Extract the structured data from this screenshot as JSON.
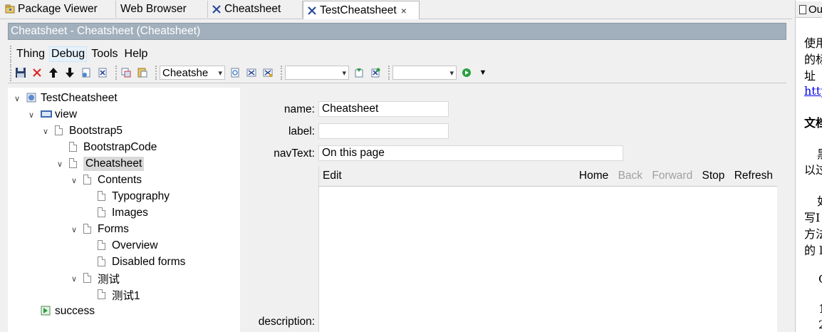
{
  "tabs": [
    {
      "label": "Package Viewer",
      "icon": "package-icon"
    },
    {
      "label": "Web Browser",
      "icon": null
    },
    {
      "label": "Cheatsheet",
      "icon": "thing-icon"
    },
    {
      "label": "TestCheatsheet",
      "icon": "thing-icon",
      "active": true,
      "close": "×"
    }
  ],
  "title_bar": "Cheatsheet - Cheatsheet  (Cheatsheet)",
  "menu": [
    "Thing",
    "Debug",
    "Tools",
    "Help"
  ],
  "toolbar": {
    "combo1_value": "Cheatshe",
    "combo2_value": "",
    "combo3_value": ""
  },
  "tree": {
    "items": [
      {
        "label": "TestCheatsheet",
        "level": 0,
        "expanded": true,
        "icon": "globe-icon"
      },
      {
        "label": "view",
        "level": 1,
        "expanded": true,
        "icon": "html-icon"
      },
      {
        "label": "Bootstrap5",
        "level": 2,
        "expanded": true,
        "icon": "doc-icon"
      },
      {
        "label": "BootstrapCode",
        "level": 3,
        "expanded": null,
        "icon": "doc-icon"
      },
      {
        "label": "Cheatsheet",
        "level": 3,
        "expanded": true,
        "icon": "doc-icon",
        "selected": true
      },
      {
        "label": "Contents",
        "level": 4,
        "expanded": true,
        "icon": "doc-icon"
      },
      {
        "label": "Typography",
        "level": 5,
        "expanded": null,
        "icon": "doc-icon"
      },
      {
        "label": "Images",
        "level": 5,
        "expanded": null,
        "icon": "doc-icon"
      },
      {
        "label": "Forms",
        "level": 4,
        "expanded": true,
        "icon": "doc-icon"
      },
      {
        "label": "Overview",
        "level": 5,
        "expanded": null,
        "icon": "doc-icon"
      },
      {
        "label": "Disabled forms",
        "level": 5,
        "expanded": null,
        "icon": "doc-icon"
      },
      {
        "label": "测试",
        "level": 4,
        "expanded": true,
        "icon": "doc-icon"
      },
      {
        "label": "测试1",
        "level": 5,
        "expanded": null,
        "icon": "doc-icon"
      },
      {
        "label": "success",
        "level": 1,
        "expanded": null,
        "icon": "action-icon"
      }
    ]
  },
  "form": {
    "name_label": "name:",
    "name_value": "Cheatsheet",
    "label_label": "label:",
    "label_value": "",
    "navtext_label": "navText:",
    "navtext_value": "On this page",
    "description_label": "description:"
  },
  "browser": {
    "edit": "Edit",
    "home": "Home",
    "back": "Back",
    "forward": "Forward",
    "stop": "Stop",
    "refresh": "Refresh"
  },
  "right_panel": {
    "tab_label": "Ou",
    "lines": [
      "使用",
      "的标",
      "址",
      "http",
      "文档",
      "黑",
      "以过",
      "如",
      "写I",
      "方法",
      "的 l",
      "C",
      "1",
      "2"
    ]
  },
  "colors": {
    "title_bar_bg": "#a2b0bd",
    "selected_bg": "#d9d9d9",
    "link": "#0000ee"
  }
}
